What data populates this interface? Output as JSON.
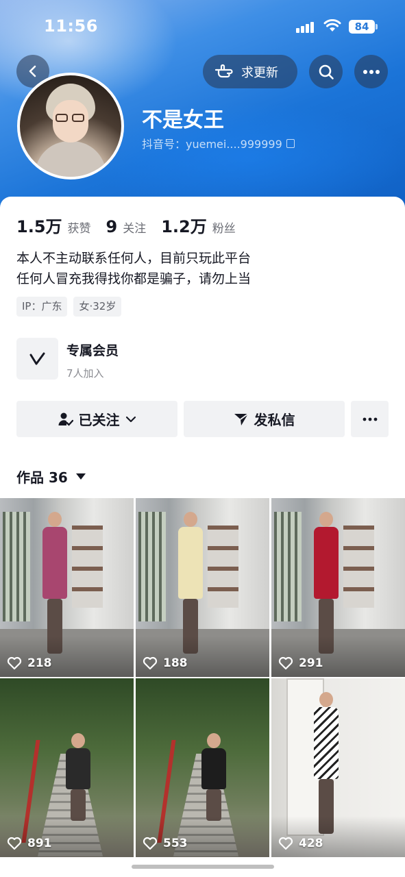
{
  "status_bar": {
    "time": "11:56",
    "battery": "84"
  },
  "header": {
    "update_label": "求更新"
  },
  "profile": {
    "name": "不是女王",
    "douyin_id": "抖音号：yuemei....999999",
    "stats": [
      {
        "num": "1.5万",
        "label": "获赞"
      },
      {
        "num": "9",
        "label": "关注"
      },
      {
        "num": "1.2万",
        "label": "粉丝"
      }
    ],
    "bio_lines": [
      "本人不主动联系任何人，目前只玩此平台",
      "任何人冒充我得找你都是骗子，请勿上当"
    ],
    "tags": [
      "IP：广东",
      "女·32岁"
    ]
  },
  "member": {
    "title": "专属会员",
    "subtitle": "7人加入"
  },
  "actions": {
    "follow_label": "已关注",
    "message_label": "发私信"
  },
  "works": {
    "header": "作品 36",
    "items": [
      {
        "likes": "218",
        "scene": "indoor",
        "dress_color": "#a8466f"
      },
      {
        "likes": "188",
        "scene": "indoor",
        "dress_color": "#ede3b6"
      },
      {
        "likes": "291",
        "scene": "indoor",
        "dress_color": "#b3192f"
      },
      {
        "likes": "891",
        "scene": "outdoor",
        "dress_color": "#2a2a2a"
      },
      {
        "likes": "553",
        "scene": "outdoor",
        "dress_color": "#1d1d1d"
      },
      {
        "likes": "428",
        "scene": "mirror",
        "dress_color": "#ffffff"
      }
    ]
  },
  "colors": {
    "accent": "#1b74d8",
    "button_bg": "#f1f2f4"
  }
}
